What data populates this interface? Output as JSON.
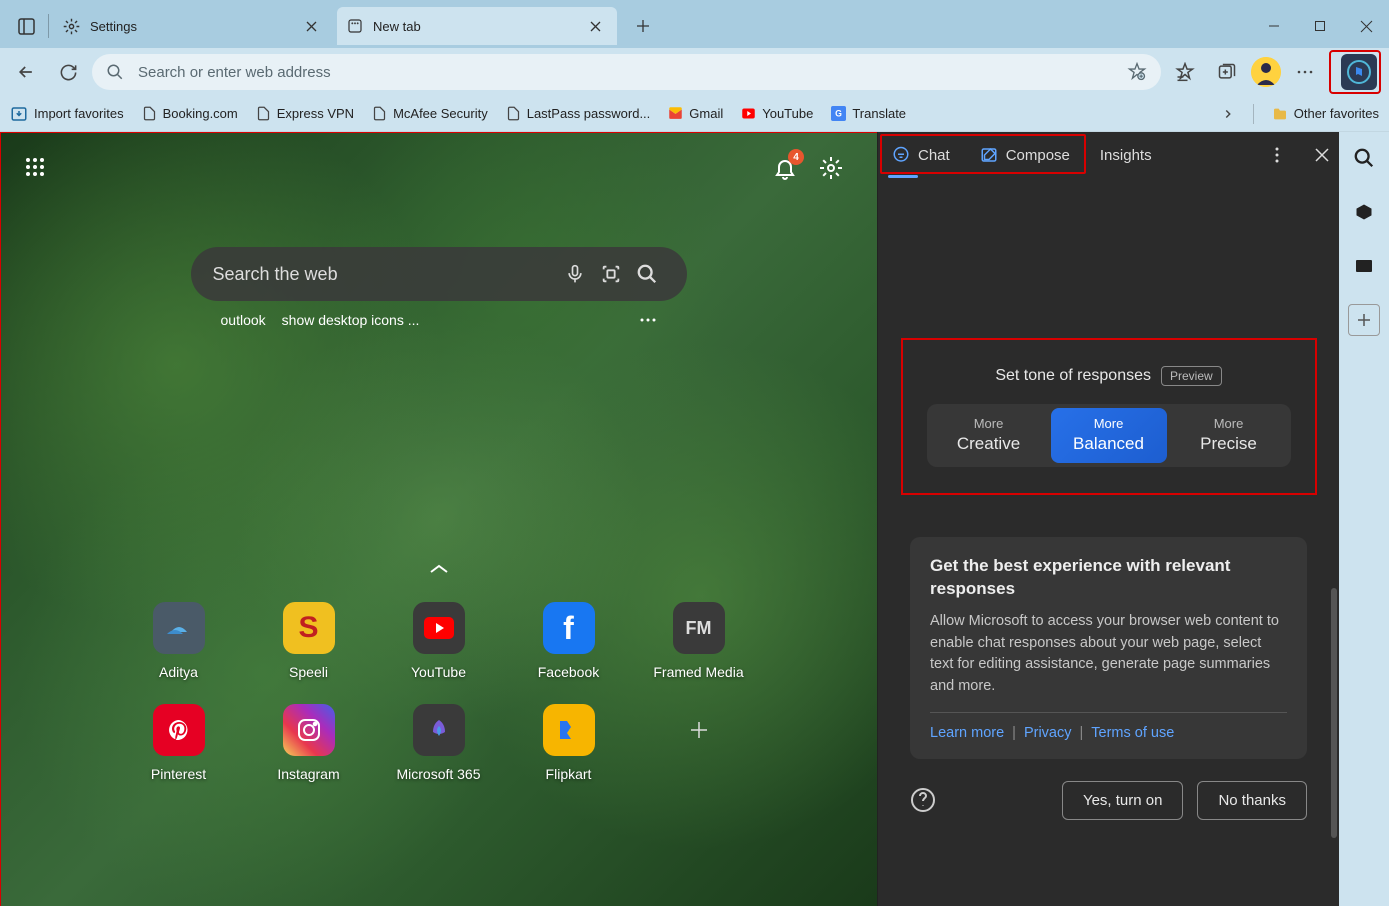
{
  "tabs": [
    {
      "title": "Settings"
    },
    {
      "title": "New tab"
    }
  ],
  "addressbar": {
    "placeholder": "Search or enter web address"
  },
  "bookmarks": {
    "import": "Import favorites",
    "items": [
      "Booking.com",
      "Express VPN",
      "McAfee Security",
      "LastPass password...",
      "Gmail",
      "YouTube",
      "Translate"
    ],
    "other": "Other favorites"
  },
  "ntp": {
    "search_placeholder": "Search the web",
    "notif_count": "4",
    "suggestions": [
      "outlook",
      "show desktop icons ..."
    ],
    "tiles_row1": [
      {
        "label": "Aditya",
        "bg": "#4a5a68"
      },
      {
        "label": "Speeli",
        "bg": "#f0c020"
      },
      {
        "label": "YouTube",
        "bg": "#e03020"
      },
      {
        "label": "Facebook",
        "bg": "#1877f2"
      },
      {
        "label": "Framed Media",
        "bg": "#3a3a3a"
      }
    ],
    "tiles_row2": [
      {
        "label": "Pinterest",
        "bg": "#e60023"
      },
      {
        "label": "Instagram",
        "bg": "#d02c80"
      },
      {
        "label": "Microsoft 365",
        "bg": "#3a3a3a"
      },
      {
        "label": "Flipkart",
        "bg": "#f7b500"
      }
    ]
  },
  "sidepanel": {
    "tabs": {
      "chat": "Chat",
      "compose": "Compose",
      "insights": "Insights"
    },
    "tone": {
      "title": "Set tone of responses",
      "badge": "Preview",
      "options": [
        {
          "line1": "More",
          "line2": "Creative"
        },
        {
          "line1": "More",
          "line2": "Balanced"
        },
        {
          "line1": "More",
          "line2": "Precise"
        }
      ]
    },
    "consent": {
      "title": "Get the best experience with relevant responses",
      "text": "Allow Microsoft to access your browser web content to enable chat responses about your web page, select text for editing assistance, generate page summaries and more.",
      "learn_more": "Learn more",
      "privacy": "Privacy",
      "terms": "Terms of use",
      "yes": "Yes, turn on",
      "no": "No thanks"
    }
  }
}
